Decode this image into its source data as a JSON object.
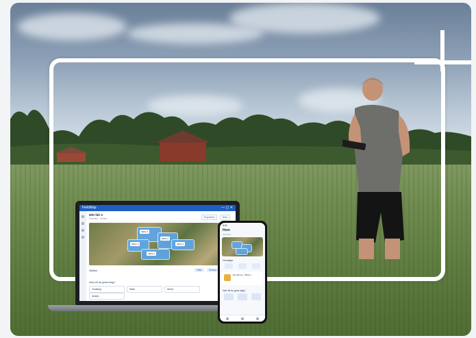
{
  "laptop_app": {
    "brand": "FieldMap",
    "window_controls": "— ▢ ✕",
    "title": "Mitt fält A",
    "subtitle": "Översikt · Skiften",
    "actions": [
      "Exportera",
      "Dela"
    ],
    "map_labels": [
      "Skifte 1",
      "Skifte 2",
      "Skifte 3",
      "Skifte 4",
      "Skifte 5"
    ],
    "row_label": "Skiften",
    "filters": [
      "Filter",
      "Sortera",
      "Visa"
    ],
    "section_label": "Vad vill du göra idag?",
    "tabs": [
      "Gödsling",
      "Sådd",
      "Skörd",
      "Analys"
    ]
  },
  "phone_app": {
    "time": "9:41",
    "title": "Hem",
    "subtitle": "Mitt fält A",
    "section": "Genvägar",
    "card_text": "Bevattning - Skifte 2",
    "section2": "Vad vill du göra idag?"
  },
  "colors": {
    "accent": "#1f5fbf",
    "parcel": "#5ea6e6",
    "frame": "#ffffff"
  }
}
